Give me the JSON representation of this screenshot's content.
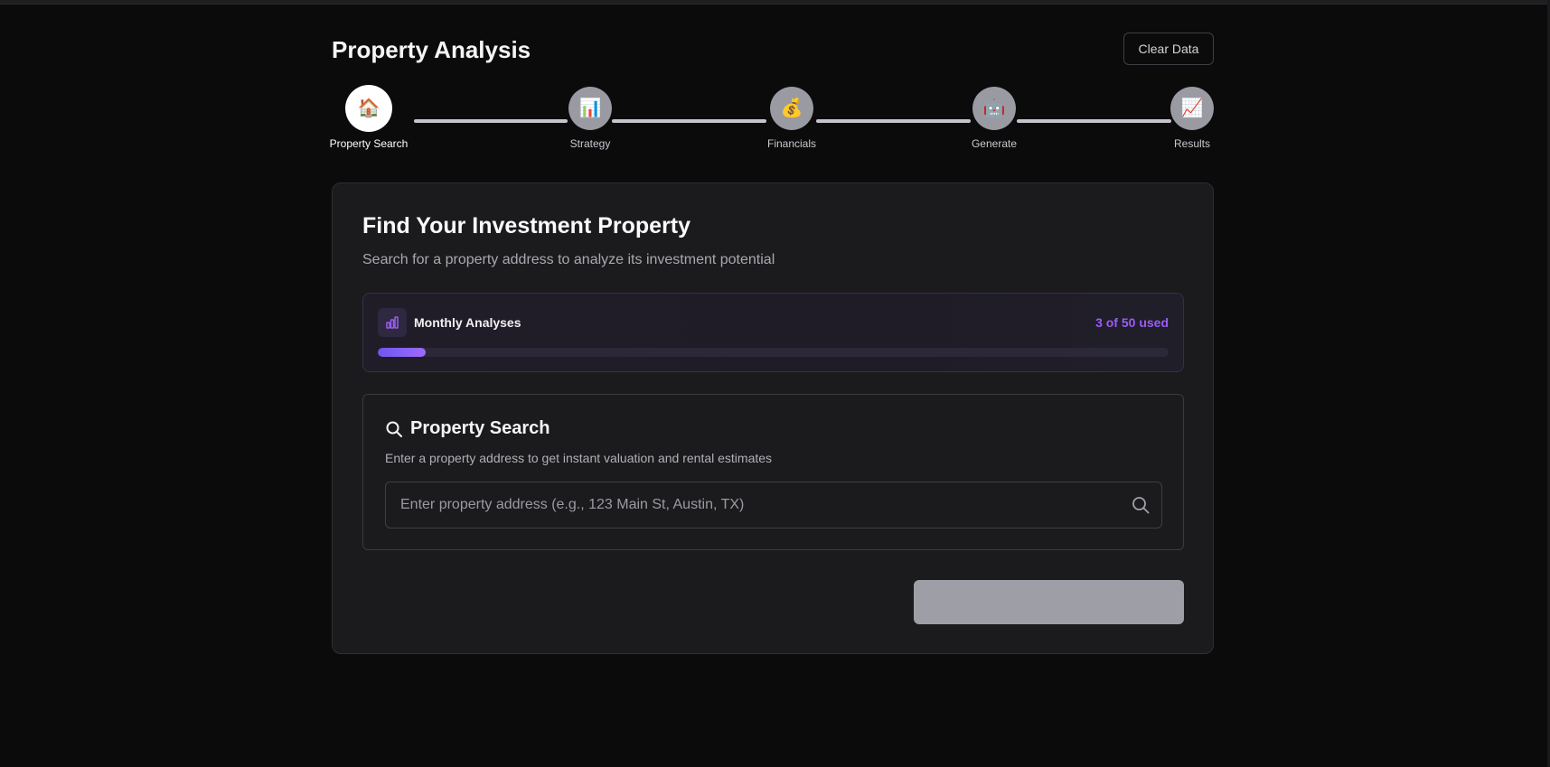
{
  "header": {
    "title": "Property Analysis",
    "clear_button": "Clear Data"
  },
  "stepper": {
    "steps": [
      {
        "label": "Property Search",
        "icon": "🏠",
        "icon_name": "house-icon",
        "active": true
      },
      {
        "label": "Strategy",
        "icon": "📊",
        "icon_name": "bar-chart-icon",
        "active": false
      },
      {
        "label": "Financials",
        "icon": "💰",
        "icon_name": "money-bag-icon",
        "active": false
      },
      {
        "label": "Generate",
        "icon": "🤖",
        "icon_name": "robot-icon",
        "active": false
      },
      {
        "label": "Results",
        "icon": "📈",
        "icon_name": "trend-chart-icon",
        "active": false
      }
    ]
  },
  "main": {
    "title": "Find Your Investment Property",
    "subtitle": "Search for a property address to analyze its investment potential",
    "usage": {
      "label": "Monthly Analyses",
      "count_text": "3 of 50 used",
      "used": 3,
      "limit": 50,
      "icon": "bar-chart-icon",
      "accent_color": "#9b5cf6"
    },
    "search": {
      "title": "Property Search",
      "description": "Enter a property address to get instant valuation and rental estimates",
      "placeholder": "Enter property address (e.g., 123 Main St, Austin, TX)",
      "value": "",
      "icon": "search-icon"
    },
    "submit_button": {
      "label": ""
    }
  },
  "colors": {
    "background": "#0b0b0c",
    "card": "#1b1b1d",
    "accent": "#9b5cf6"
  }
}
